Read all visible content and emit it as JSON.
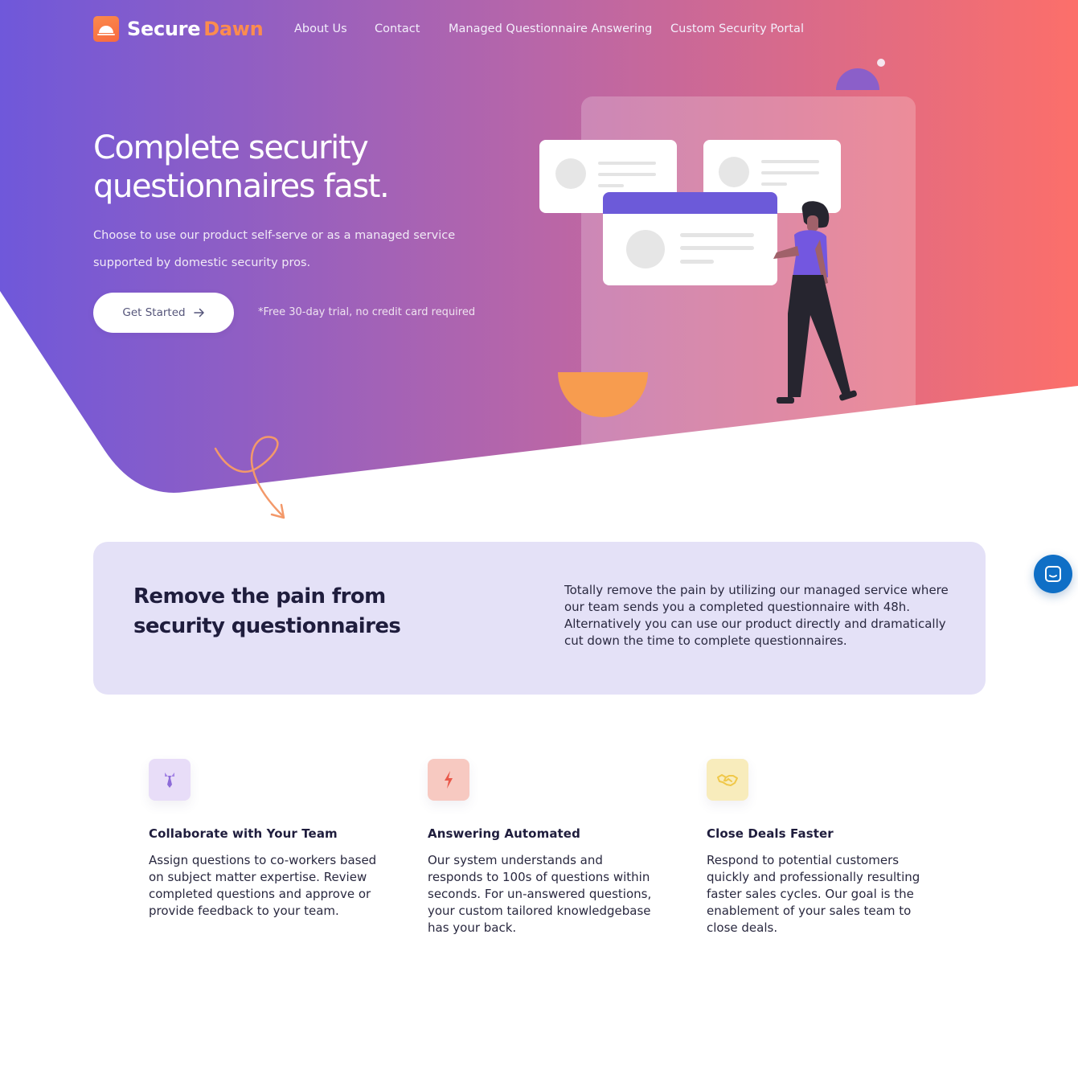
{
  "brand": {
    "name_part1": "Secure",
    "name_part2": "Dawn"
  },
  "nav": {
    "links": [
      {
        "label": "About Us"
      },
      {
        "label": "Contact"
      },
      {
        "label": "Managed Questionnaire Answering"
      },
      {
        "label": "Custom Security Portal"
      }
    ]
  },
  "hero": {
    "title": "Complete security questionnaires fast.",
    "subtitle": "Choose to use our product self-serve or as a managed service supported by domestic security pros.",
    "cta_label": "Get Started",
    "trial_note": "*Free 30-day trial, no credit card required"
  },
  "intro": {
    "title": "Remove the pain from security questionnaires",
    "text": "Totally remove the pain by utilizing our managed service where our team sends you a completed questionnaire with 48h. Alternatively you can use our product directly and dramatically cut down the time to complete questionnaires."
  },
  "features": [
    {
      "icon": "tie-icon",
      "title": "Collaborate with Your Team",
      "text": "Assign questions to co-workers based on subject matter expertise. Review completed questions and approve or provide feedback to your team."
    },
    {
      "icon": "lightning-icon",
      "title": "Answering Automated",
      "text": "Our system understands and responds to 100s of questions within seconds. For un-answered questions, your custom tailored knowledgebase has your back."
    },
    {
      "icon": "handshake-icon",
      "title": "Close Deals Faster",
      "text": "Respond to potential customers quickly and professionally resulting faster sales cycles. Our goal is the enablement of your sales team to close deals."
    }
  ],
  "colors": {
    "gradient_start": "#7357d9",
    "gradient_mid": "#b965a6",
    "gradient_end": "#fb6e6c",
    "accent_orange": "#fb8c4f",
    "card_bg": "#e4e1f7",
    "chat_blue": "#0f6fc6"
  },
  "icons": {
    "logo": "sunrise-icon",
    "cta": "arrow-right-icon",
    "chat": "chat-icon"
  }
}
